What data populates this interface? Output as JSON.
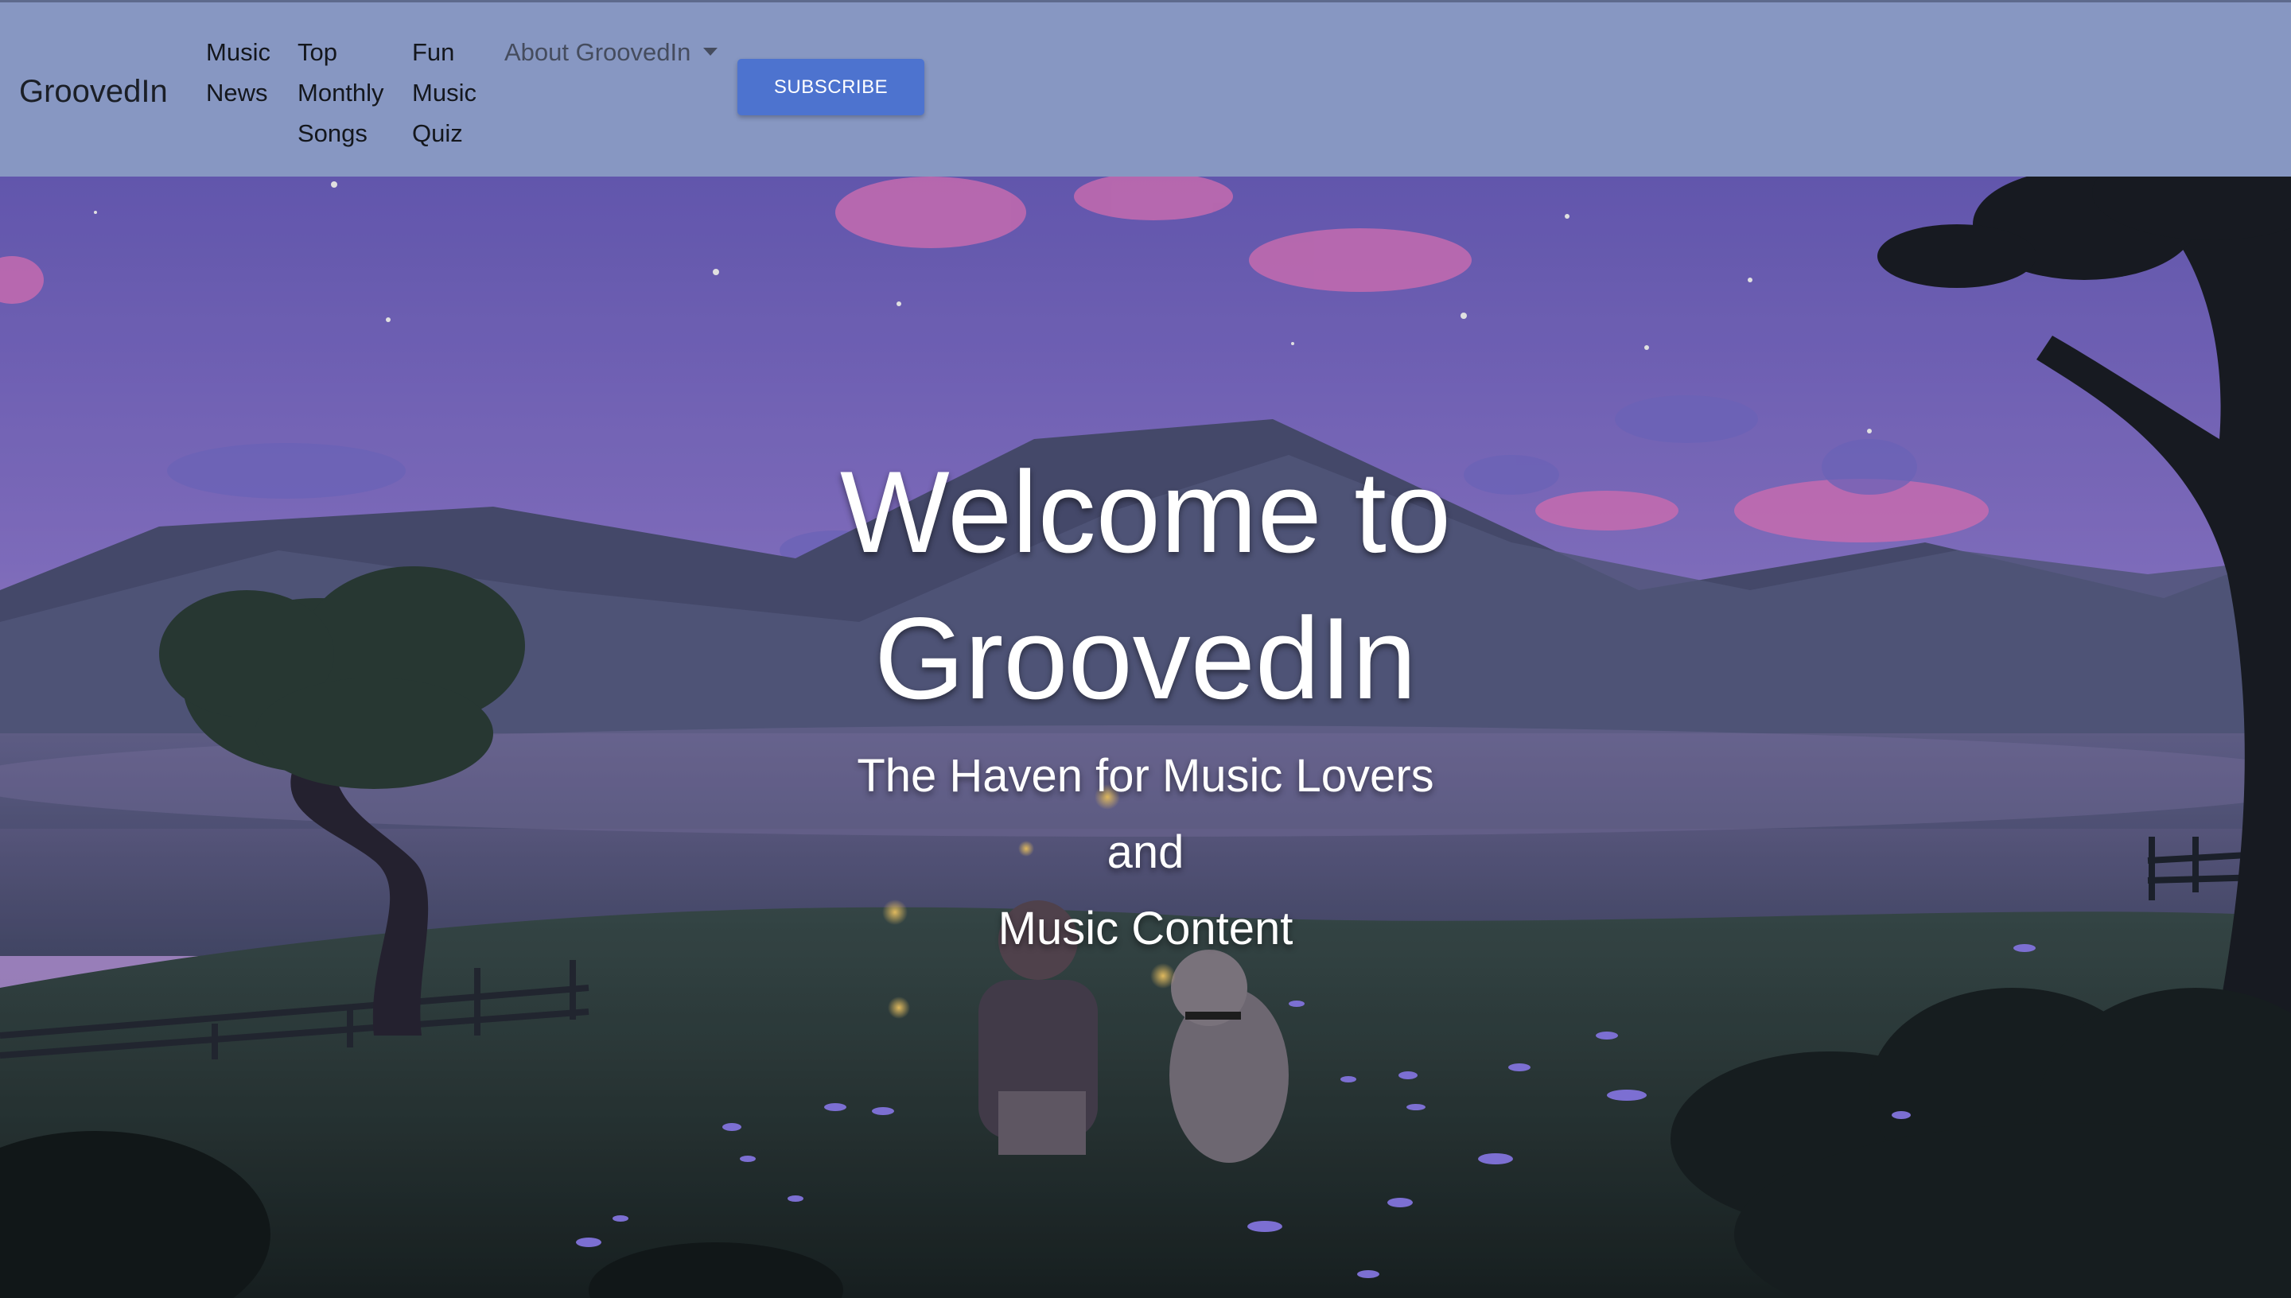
{
  "navbar": {
    "brand": "GroovedIn",
    "links": [
      {
        "lines": [
          "Music",
          "News"
        ]
      },
      {
        "lines": [
          "Top",
          "Monthly",
          "Songs"
        ]
      },
      {
        "lines": [
          "Fun",
          "Music",
          "Quiz"
        ]
      }
    ],
    "about_label": "About GroovedIn",
    "subscribe_label": "SUBSCRIBE"
  },
  "hero": {
    "title_lines": [
      "Welcome to",
      "GroovedIn"
    ],
    "subtitle_lines": [
      "The Haven for Music Lovers",
      "and",
      "Music Content"
    ]
  },
  "colors": {
    "navbar_bg": "#8797c2",
    "subscribe_bg": "#4d73cf",
    "hero_text": "#ffffff"
  },
  "icons": {
    "about_dropdown": "caret-down-icon"
  }
}
